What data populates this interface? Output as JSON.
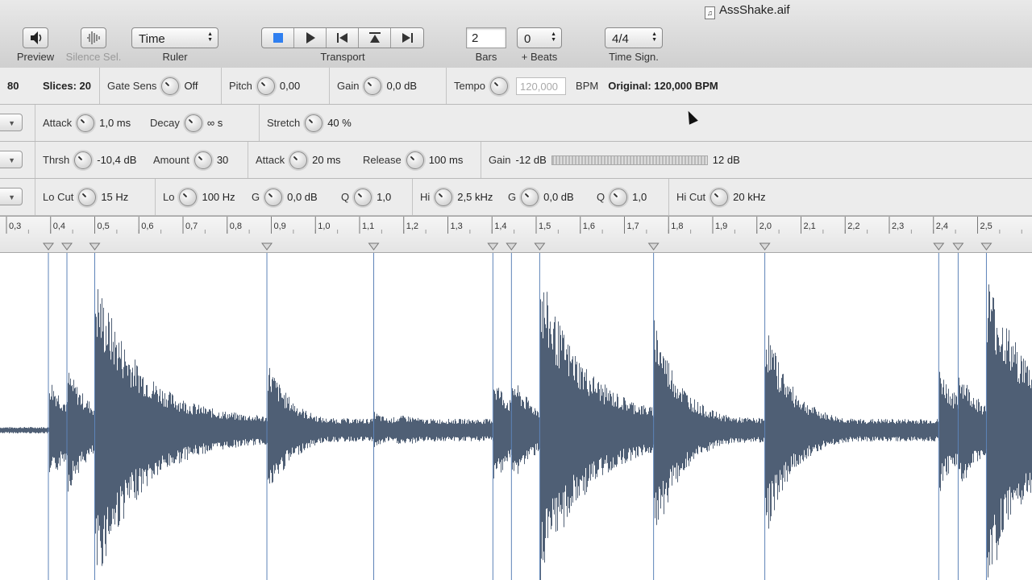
{
  "window": {
    "file_name": "AssShake.aif"
  },
  "toolbar": {
    "preview_label": "Preview",
    "silence_label": "Silence Sel.",
    "ruler_value": "Time",
    "ruler_label": "Ruler",
    "transport_label": "Transport",
    "bars_value": "2",
    "bars_label": "Bars",
    "beats_value": "0",
    "beats_label": "+ Beats",
    "timesig_value": "4/4",
    "timesig_label": "Time Sign."
  },
  "row1": {
    "left_value": "80",
    "slices": "Slices: 20",
    "gate_label": "Gate Sens",
    "gate_value": "Off",
    "pitch_label": "Pitch",
    "pitch_value": "0,00",
    "gain_label": "Gain",
    "gain_value": "0,0 dB",
    "tempo_label": "Tempo",
    "tempo_value": "120,000",
    "bpm_label": "BPM",
    "original": "Original: 120,000 BPM"
  },
  "row2": {
    "attack_label": "Attack",
    "attack_value": "1,0 ms",
    "decay_label": "Decay",
    "decay_value": "∞ s",
    "stretch_label": "Stretch",
    "stretch_value": "40 %"
  },
  "row3": {
    "thrsh_label": "Thrsh",
    "thrsh_value": "-10,4 dB",
    "amount_label": "Amount",
    "amount_value": "30",
    "attack_label": "Attack",
    "attack_value": "20 ms",
    "release_label": "Release",
    "release_value": "100 ms",
    "gain_label": "Gain",
    "gain_min": "-12 dB",
    "gain_max": "12 dB"
  },
  "row4": {
    "locut_label": "Lo Cut",
    "locut_value": "15 Hz",
    "lo_label": "Lo",
    "lo_value": "100 Hz",
    "g1_label": "G",
    "g1_value": "0,0 dB",
    "q1_label": "Q",
    "q1_value": "1,0",
    "hi_label": "Hi",
    "hi_value": "2,5 kHz",
    "g2_label": "G",
    "g2_value": "0,0 dB",
    "q2_label": "Q",
    "q2_value": "1,0",
    "hicut_label": "Hi Cut",
    "hicut_value": "20 kHz"
  },
  "ruler": {
    "ticks": [
      "0,3",
      "0,4",
      "0,5",
      "0,6",
      "0,7",
      "0,8",
      "0,9",
      "1,0",
      "1,1",
      "1,2",
      "1,3",
      "1,4",
      "1,5",
      "1,6",
      "1,7",
      "1,8",
      "1,9",
      "2,0",
      "2,1",
      "2,2",
      "2,3",
      "2,4",
      "2,5"
    ],
    "slice_times": [
      0.395,
      0.437,
      0.5,
      0.89,
      1.132,
      1.402,
      1.444,
      1.508,
      1.766,
      2.018,
      2.412,
      2.456,
      2.52
    ]
  },
  "colors": {
    "waveform": "#4f5f75",
    "slice_line": "#5d83b8"
  }
}
